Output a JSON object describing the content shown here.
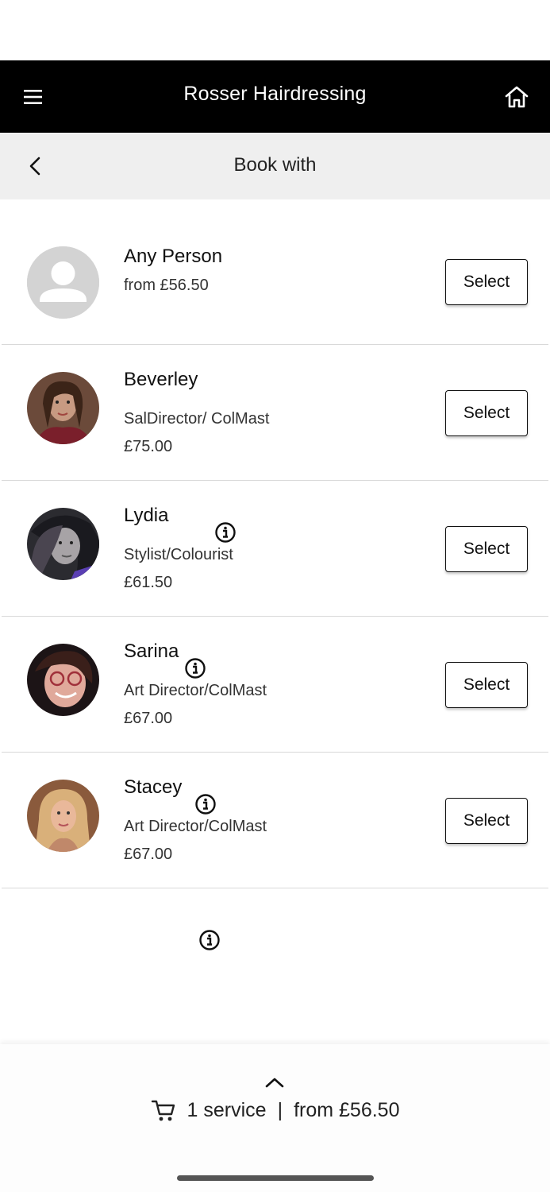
{
  "header": {
    "title": "Rosser Hairdressing",
    "menu_icon": "hamburger-menu-icon",
    "home_icon": "home-icon"
  },
  "subheader": {
    "title": "Book with",
    "back_icon": "chevron-left-icon"
  },
  "staff": [
    {
      "name": "Any Person",
      "role": "",
      "price": "from £56.50",
      "select_label": "Select",
      "has_info": false
    },
    {
      "name": "Beverley",
      "role": "SalDirector/ ColMast",
      "price": "£75.00",
      "select_label": "Select",
      "has_info": true
    },
    {
      "name": "Lydia",
      "role": "Stylist/Colourist",
      "price": "£61.50",
      "select_label": "Select",
      "has_info": true
    },
    {
      "name": "Sarina",
      "role": "Art Director/ColMast",
      "price": "£67.00",
      "select_label": "Select",
      "has_info": true
    },
    {
      "name": "Stacey",
      "role": "Art Director/ColMast",
      "price": "£67.00",
      "select_label": "Select",
      "has_info": true
    }
  ],
  "cart": {
    "service_count": "1 service",
    "separator": "|",
    "total": "from £56.50",
    "icon": "shopping-cart-icon",
    "expand_icon": "chevron-up-icon"
  },
  "colors": {
    "header_bg": "#000000",
    "subheader_bg": "#efefef",
    "divider": "#d9d9d9",
    "placeholder_avatar": "#d3d3d3"
  }
}
